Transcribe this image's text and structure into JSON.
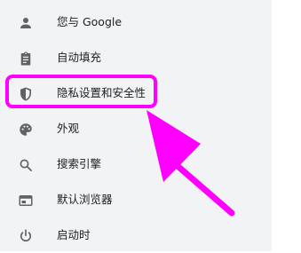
{
  "sidebar": {
    "items": [
      {
        "label": "您与 Google",
        "icon": "person-icon"
      },
      {
        "label": "自动填充",
        "icon": "clipboard-icon"
      },
      {
        "label": "隐私设置和安全性",
        "icon": "shield-icon"
      },
      {
        "label": "外观",
        "icon": "palette-icon"
      },
      {
        "label": "搜索引擎",
        "icon": "search-icon"
      },
      {
        "label": "默认浏览器",
        "icon": "browser-icon"
      },
      {
        "label": "启动时",
        "icon": "power-icon"
      }
    ]
  },
  "annotation": {
    "color": "#ff00ff",
    "icon": "arrow-icon"
  },
  "colors": {
    "sidebar_background": "#f1f3f4",
    "icon": "#5f6368",
    "text": "#202124"
  }
}
